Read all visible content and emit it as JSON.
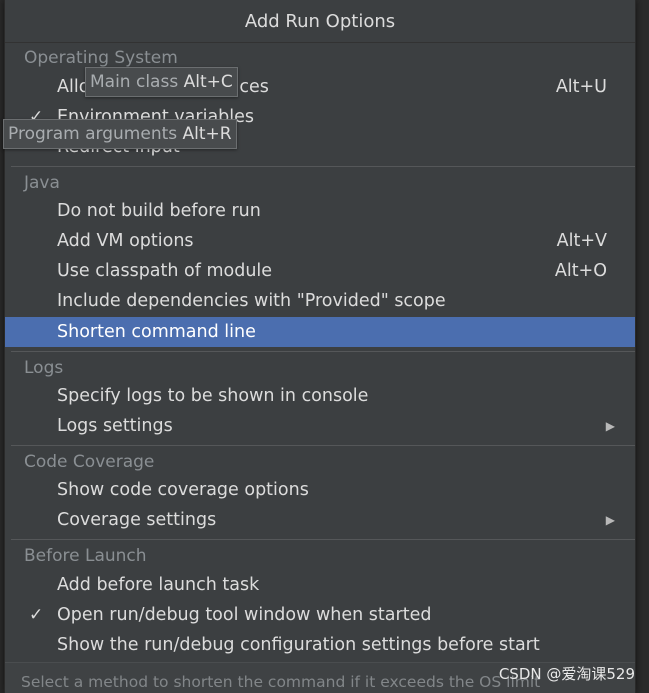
{
  "popup": {
    "title": "Add Run Options",
    "sections": {
      "os": {
        "header": "Operating System",
        "items": [
          {
            "label": "Allow multiple instances",
            "label_visible": "Allo",
            "label_tail": "ces",
            "shortcut": "Alt+U",
            "checked": false
          },
          {
            "label": "Environment variables",
            "checked": true
          },
          {
            "label": "Redirect input",
            "checked": false
          }
        ]
      },
      "java": {
        "header": "Java",
        "items": [
          {
            "label": "Do not build before run",
            "shortcut": ""
          },
          {
            "label": "Add VM options",
            "shortcut": "Alt+V"
          },
          {
            "label": "Use classpath of module",
            "shortcut": "Alt+O"
          },
          {
            "label": "Include dependencies with \"Provided\" scope",
            "shortcut": ""
          },
          {
            "label": "Shorten command line",
            "shortcut": "",
            "selected": true
          }
        ]
      },
      "logs": {
        "header": "Logs",
        "items": [
          {
            "label": "Specify logs to be shown in console"
          },
          {
            "label": "Logs settings",
            "submenu": true
          }
        ]
      },
      "coverage": {
        "header": "Code Coverage",
        "items": [
          {
            "label": "Show code coverage options"
          },
          {
            "label": "Coverage settings",
            "submenu": true
          }
        ]
      },
      "before_launch": {
        "header": "Before Launch",
        "items": [
          {
            "label": "Add before launch task",
            "checked": false
          },
          {
            "label": "Open run/debug tool window when started",
            "checked": true
          },
          {
            "label": "Show the run/debug configuration settings before start",
            "checked": false
          }
        ]
      }
    },
    "check_glyph": "✓",
    "submenu_glyph": "▶",
    "footer": "Select a method to shorten the command if it exceeds the OS limit"
  },
  "tooltips": {
    "main_class": {
      "text": "Main class ",
      "key": "Alt+C"
    },
    "program_args": {
      "text": "Program arguments ",
      "key": "Alt+R"
    }
  },
  "watermark": "CSDN @爱淘课529",
  "colors": {
    "popup_bg": "#3c3f41",
    "selection": "#4b6eaf",
    "section_header": "#8a8f93",
    "text": "#dcdcdc"
  }
}
